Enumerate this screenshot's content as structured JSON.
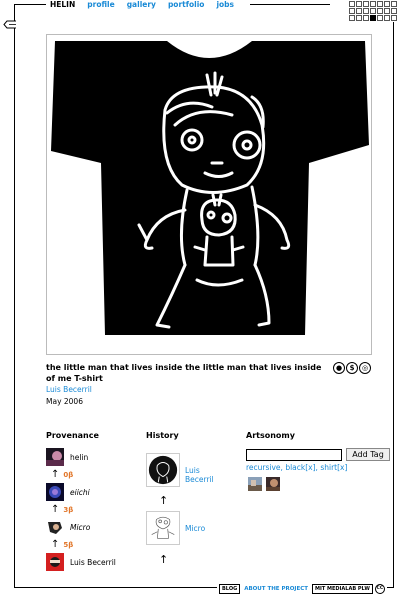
{
  "nav": {
    "home": "HELIN",
    "links": [
      "profile",
      "gallery",
      "portfolio",
      "jobs"
    ]
  },
  "artwork": {
    "title": "the little man that lives inside the little man that lives inside of me T-shirt",
    "author": "Luis Becerril",
    "date": "May 2006"
  },
  "license_icons": [
    "cc-by-icon",
    "cc-nc-icon",
    "cc-sa-icon"
  ],
  "provenance": {
    "heading": "Provenance",
    "entries": [
      {
        "name": "helin",
        "italic": false,
        "credits": "0β"
      },
      {
        "name": "eiichi",
        "italic": true,
        "credits": "3β"
      },
      {
        "name": "Micro",
        "italic": true,
        "credits": "5β"
      },
      {
        "name": "Luis Becerril",
        "italic": false
      }
    ]
  },
  "history": {
    "heading": "History",
    "entries": [
      "Luis Becerril",
      "Micro"
    ]
  },
  "artsonomy": {
    "heading": "Artsonomy",
    "input_value": "",
    "button_label": "Add Tag",
    "tags": [
      {
        "label": "recursive",
        "sep": ", "
      },
      {
        "label": "black",
        "remove": "[x]",
        "sep": ", "
      },
      {
        "label": "shirt",
        "remove": "[x]"
      }
    ]
  },
  "footer": {
    "blog": "BLOG",
    "about": "ABOUT THE PROJECT",
    "mit": "MIT MEDIALAB PLW",
    "cc": "CC"
  },
  "colors": {
    "link": "#1a8ad6",
    "credit": "#e2772b"
  }
}
